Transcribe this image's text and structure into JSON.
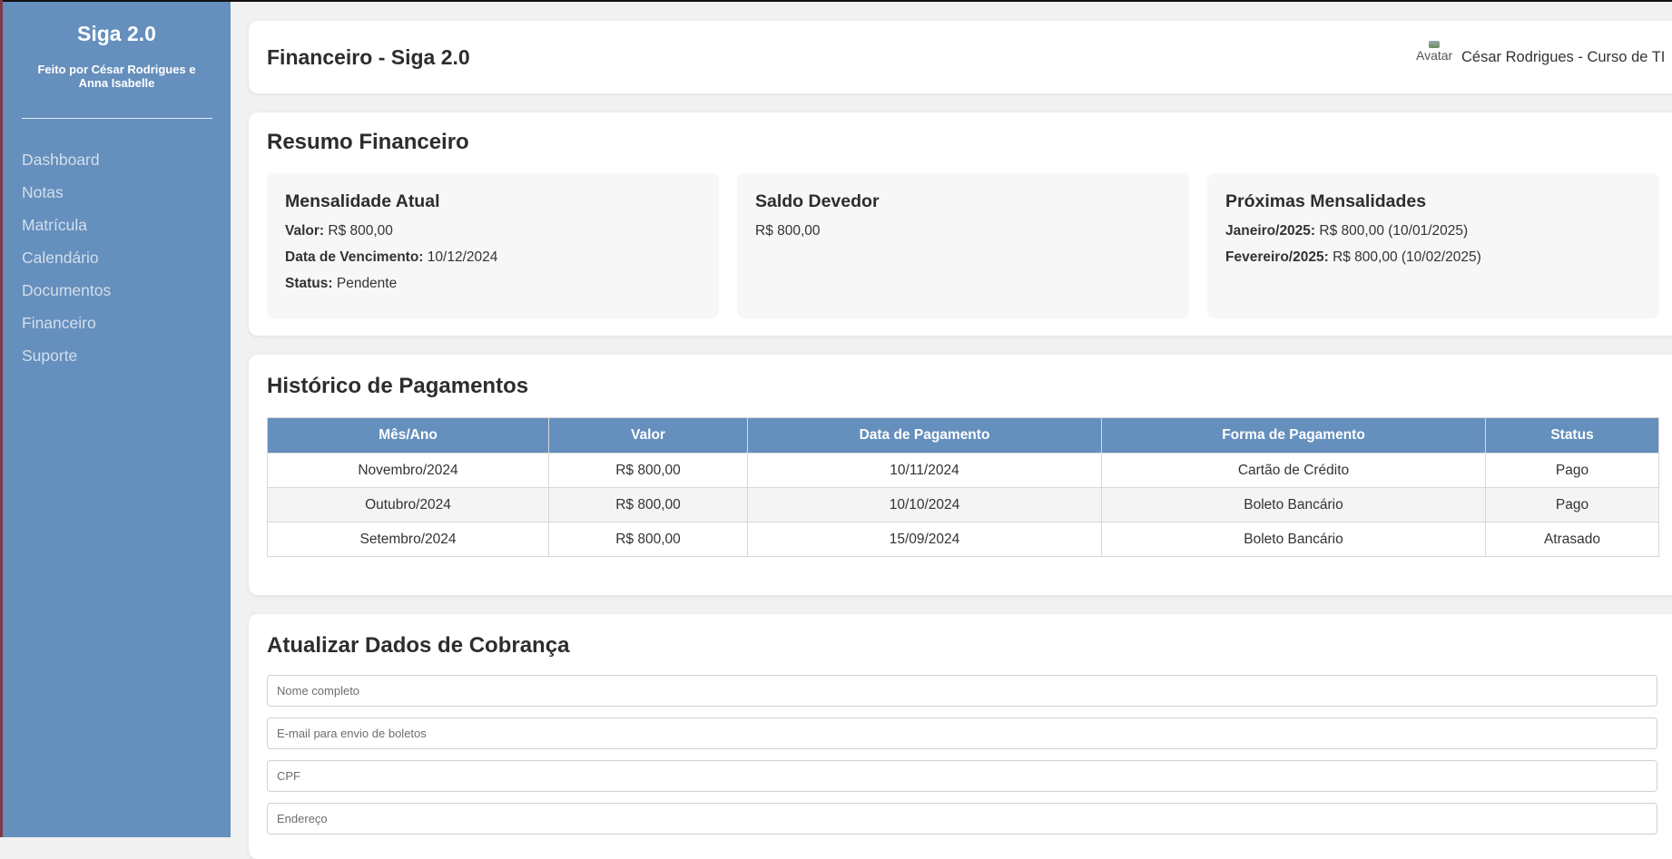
{
  "sidebar": {
    "brand": "Siga 2.0",
    "credits": "Feito por César Rodrigues e Anna Isabelle",
    "items": [
      {
        "label": "Dashboard"
      },
      {
        "label": "Notas"
      },
      {
        "label": "Matrícula"
      },
      {
        "label": "Calendário"
      },
      {
        "label": "Documentos"
      },
      {
        "label": "Financeiro"
      },
      {
        "label": "Suporte"
      }
    ]
  },
  "header": {
    "title": "Financeiro - Siga 2.0",
    "avatar_alt": "Avatar",
    "user": "César Rodrigues - Curso de TI"
  },
  "summary": {
    "title": "Resumo Financeiro",
    "current": {
      "title": "Mensalidade Atual",
      "value_label": "Valor:",
      "value": "R$ 800,00",
      "due_label": "Data de Vencimento:",
      "due": "10/12/2024",
      "status_label": "Status:",
      "status": "Pendente"
    },
    "balance": {
      "title": "Saldo Devedor",
      "value": "R$ 800,00"
    },
    "upcoming": {
      "title": "Próximas Mensalidades",
      "items": [
        {
          "label": "Janeiro/2025:",
          "value": "R$ 800,00 (10/01/2025)"
        },
        {
          "label": "Fevereiro/2025:",
          "value": "R$ 800,00 (10/02/2025)"
        }
      ]
    }
  },
  "history": {
    "title": "Histórico de Pagamentos",
    "columns": [
      "Mês/Ano",
      "Valor",
      "Data de Pagamento",
      "Forma de Pagamento",
      "Status"
    ],
    "rows": [
      [
        "Novembro/2024",
        "R$ 800,00",
        "10/11/2024",
        "Cartão de Crédito",
        "Pago"
      ],
      [
        "Outubro/2024",
        "R$ 800,00",
        "10/10/2024",
        "Boleto Bancário",
        "Pago"
      ],
      [
        "Setembro/2024",
        "R$ 800,00",
        "15/09/2024",
        "Boleto Bancário",
        "Atrasado"
      ]
    ]
  },
  "billing": {
    "title": "Atualizar Dados de Cobrança",
    "fields": [
      {
        "placeholder": "Nome completo"
      },
      {
        "placeholder": "E-mail para envio de boletos"
      },
      {
        "placeholder": "CPF"
      },
      {
        "placeholder": "Endereço"
      }
    ]
  },
  "colors": {
    "sidebar": "#658fbd",
    "table_header": "#658fbd",
    "page_background": "#f1f1f1"
  }
}
